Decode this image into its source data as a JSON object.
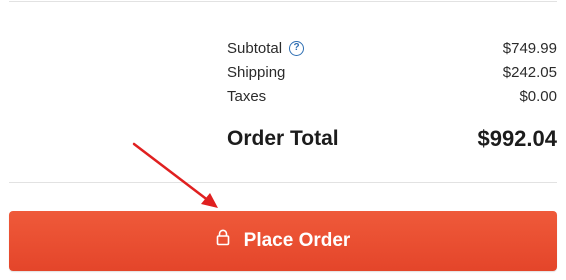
{
  "summary": {
    "subtotal_label": "Subtotal",
    "subtotal_value": "$749.99",
    "shipping_label": "Shipping",
    "shipping_value": "$242.05",
    "taxes_label": "Taxes",
    "taxes_value": "$0.00",
    "total_label": "Order Total",
    "total_value": "$992.04",
    "help_icon_glyph": "?"
  },
  "actions": {
    "place_order_label": "Place Order"
  },
  "icons": {
    "help": "question-circle-icon",
    "lock": "lock-icon",
    "annotation": "red-arrow-annotation"
  },
  "colors": {
    "button": "#e94e30",
    "help_icon": "#2f6fb3",
    "arrow": "#e02020"
  }
}
